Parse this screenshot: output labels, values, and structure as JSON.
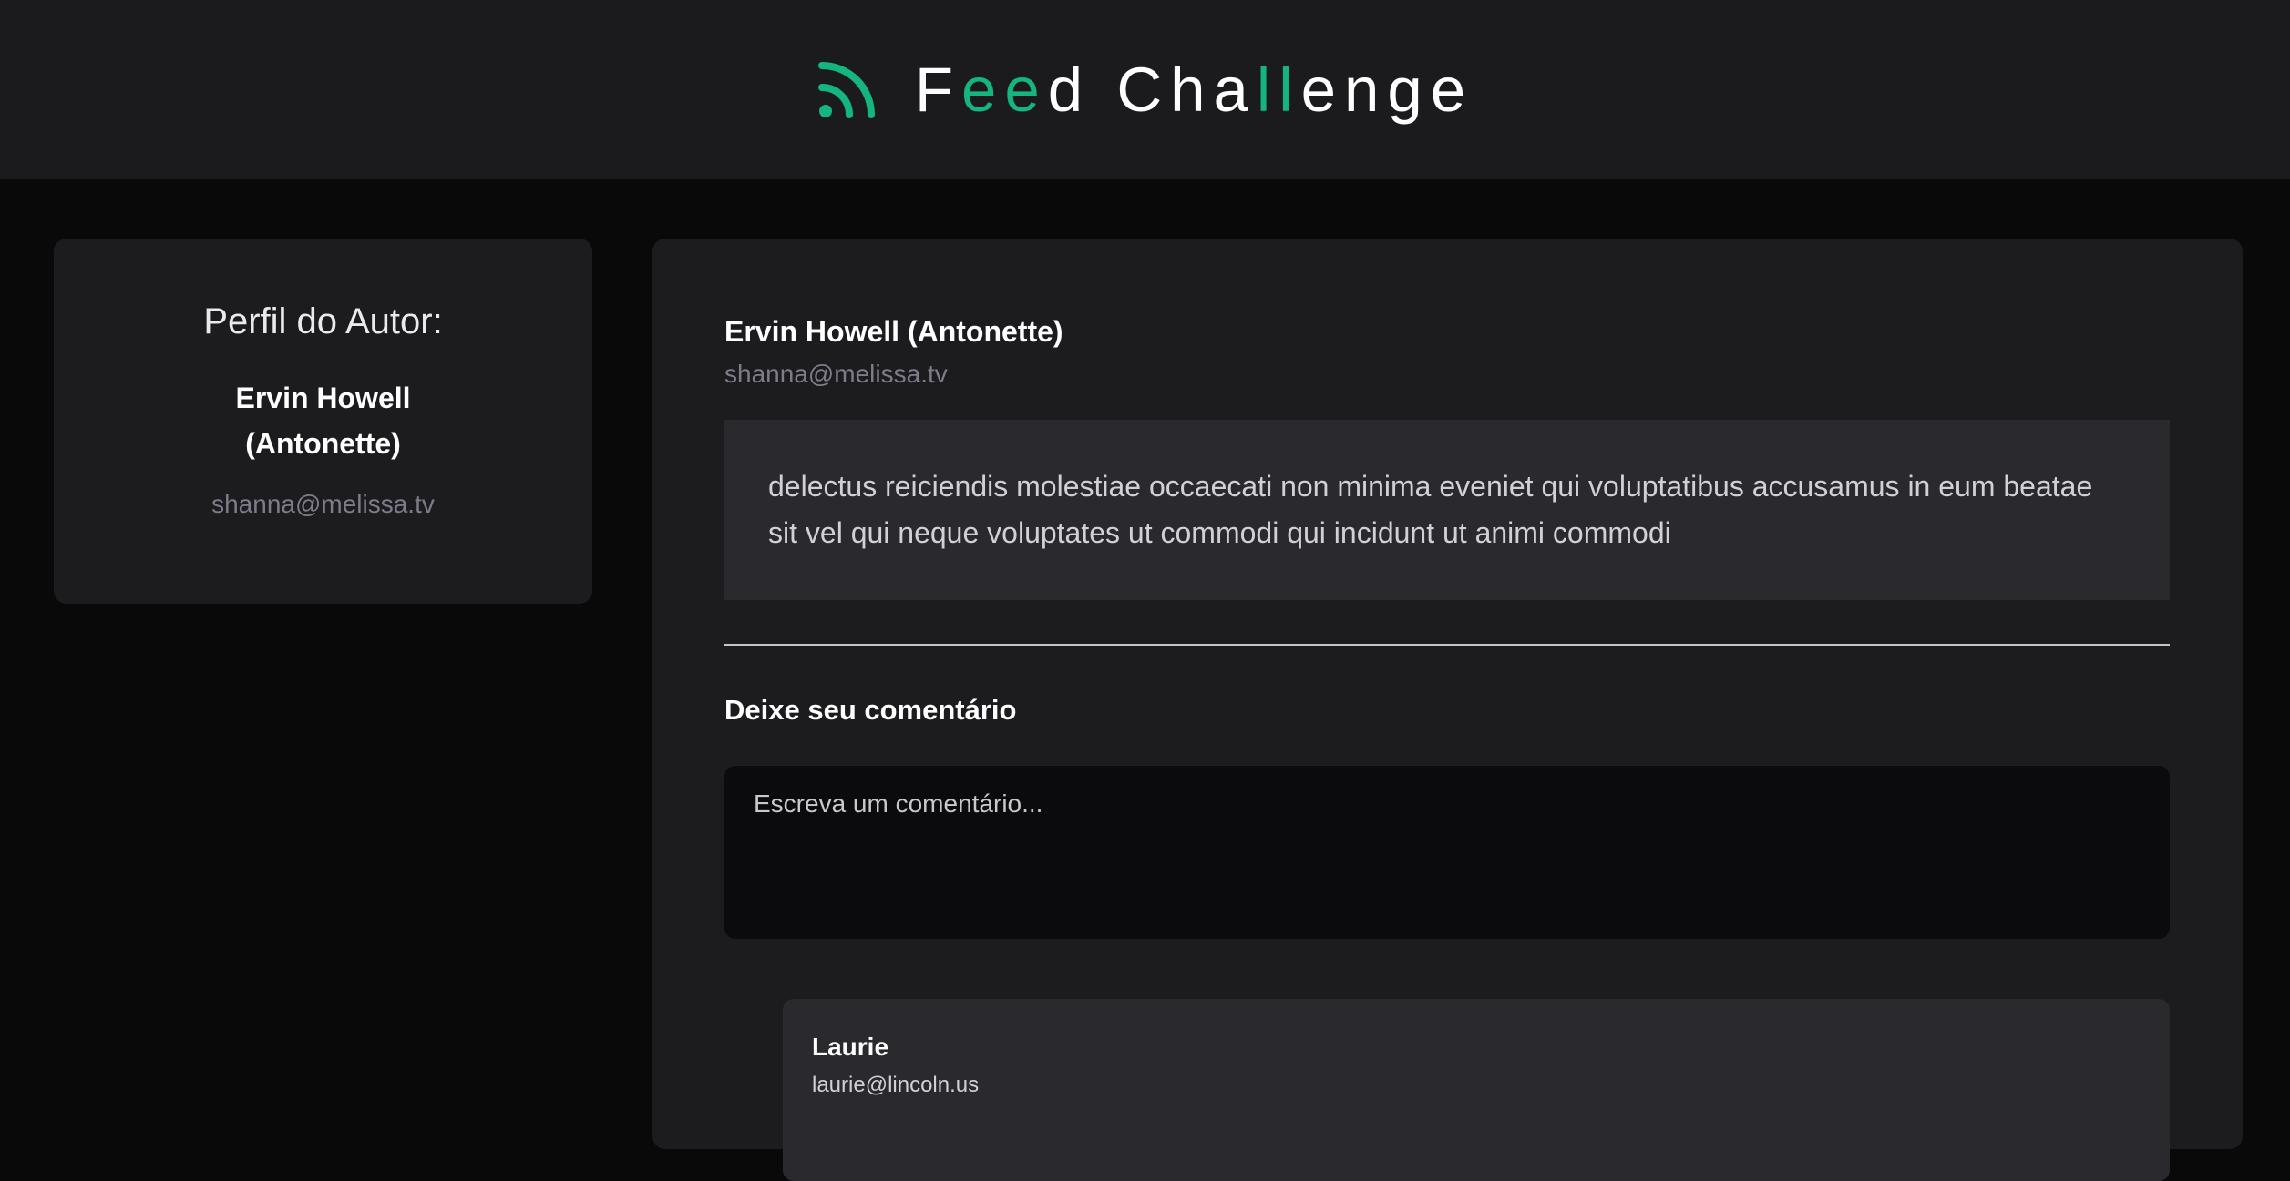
{
  "header": {
    "logo_icon": "rss-feed-icon",
    "accent_color": "#14b57e",
    "title_parts": [
      {
        "text": "F",
        "accent": false
      },
      {
        "text": "ee",
        "accent": true
      },
      {
        "text": "d Cha",
        "accent": false
      },
      {
        "text": "ll",
        "accent": true
      },
      {
        "text": "enge",
        "accent": false
      }
    ]
  },
  "sidebar": {
    "heading": "Perfil do Autor:",
    "author_name": "Ervin Howell (Antonette)",
    "author_email": "shanna@melissa.tv"
  },
  "post": {
    "author": "Ervin Howell (Antonette)",
    "email": "shanna@melissa.tv",
    "body": "delectus reiciendis molestiae occaecati non minima eveniet qui voluptatibus accusamus in eum beatae sit vel qui neque voluptates ut commodi qui incidunt ut animi commodi"
  },
  "comment_form": {
    "heading": "Deixe seu comentário",
    "placeholder": "Escreva um comentário..."
  },
  "comments": [
    {
      "author": "Laurie",
      "email": "laurie@lincoln.us",
      "body": ""
    }
  ]
}
